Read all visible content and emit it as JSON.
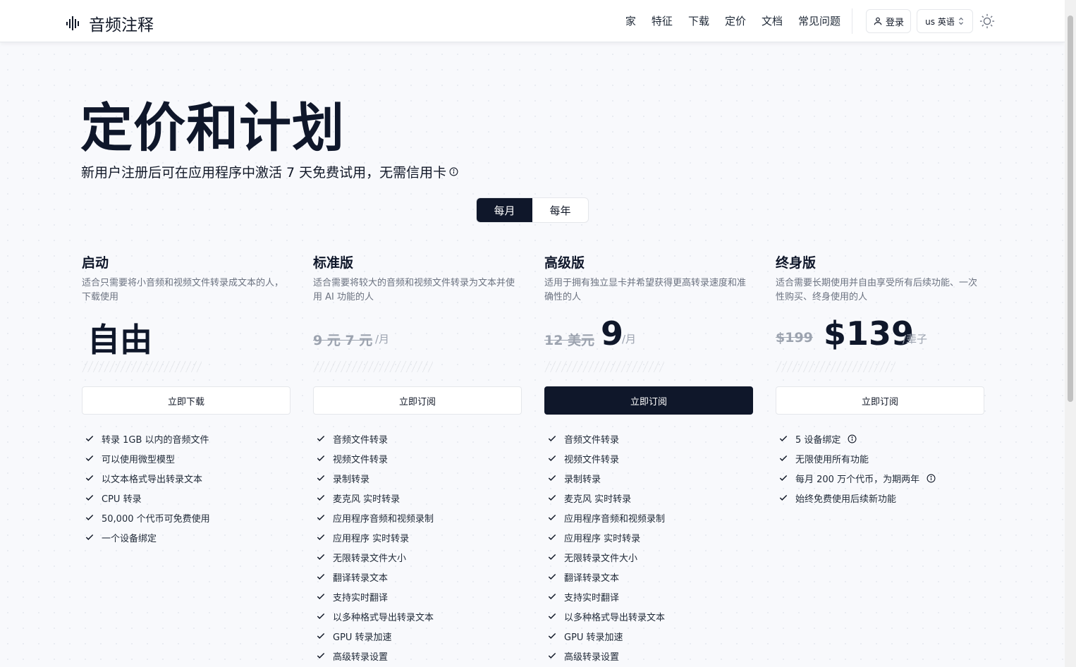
{
  "header": {
    "logo_text": "音频注释",
    "nav": [
      "家",
      "特征",
      "下载",
      "定价",
      "文档",
      "常见问题"
    ],
    "login_label": "登录",
    "lang_label": "us 英语"
  },
  "hero": {
    "title": "定价和计划",
    "subtitle": "新用户注册后可在应用程序中激活 7 天免费试用，无需信用卡"
  },
  "billing_toggle": {
    "monthly": "每月",
    "yearly": "每年",
    "selected": "monthly"
  },
  "plans": [
    {
      "name": "启动",
      "desc": "适合只需要将小音频和视频文件转录成文本的人，下载使用",
      "price_main": "自由",
      "cta": "立即下载",
      "features": [
        "转录 1GB 以内的音频文件",
        "可以使用微型模型",
        "以文本格式导出转录文本",
        "CPU 转录",
        "50,000 个代币可免费使用",
        "一个设备绑定"
      ]
    },
    {
      "name": "标准版",
      "desc": "适合需要将较大的音频和视频文件转录为文本并使用 AI 功能的人",
      "price_old": "9 元 7 元",
      "price_unit": "/月",
      "cta": "立即订阅",
      "features": [
        "音频文件转录",
        "视频文件转录",
        "录制转录",
        "麦克风 实时转录",
        "应用程序音频和视频录制",
        "应用程序 实时转录",
        "无限转录文件大小",
        "翻译转录文本",
        "支持实时翻译",
        "以多种格式导出转录文本",
        "GPU 转录加速",
        "高级转录设置"
      ]
    },
    {
      "name": "高级版",
      "desc": "适用于拥有独立显卡并希望获得更高转录速度和准确性的人",
      "price_old": "12 美元",
      "price_new": "9",
      "price_unit": "/月",
      "cta": "立即订阅",
      "features": [
        "音频文件转录",
        "视频文件转录",
        "录制转录",
        "麦克风 实时转录",
        "应用程序音频和视频录制",
        "应用程序 实时转录",
        "无限转录文件大小",
        "翻译转录文本",
        "支持实时翻译",
        "以多种格式导出转录文本",
        "GPU 转录加速",
        "高级转录设置"
      ]
    },
    {
      "name": "终身版",
      "desc": "适合需要长期使用并自由享受所有后续功能、一次性购买、终身使用的人",
      "price_old": "$199",
      "price_new": "$139",
      "price_unit": "/辈子",
      "cta": "立即订阅",
      "features": [
        "5 设备绑定",
        "无限使用所有功能",
        "每月 200 万个代币，为期两年",
        "始终免费使用后续新功能"
      ]
    }
  ],
  "colors": {
    "primary": "#0f172a",
    "muted": "#6b7280",
    "border": "#e5e7eb"
  }
}
